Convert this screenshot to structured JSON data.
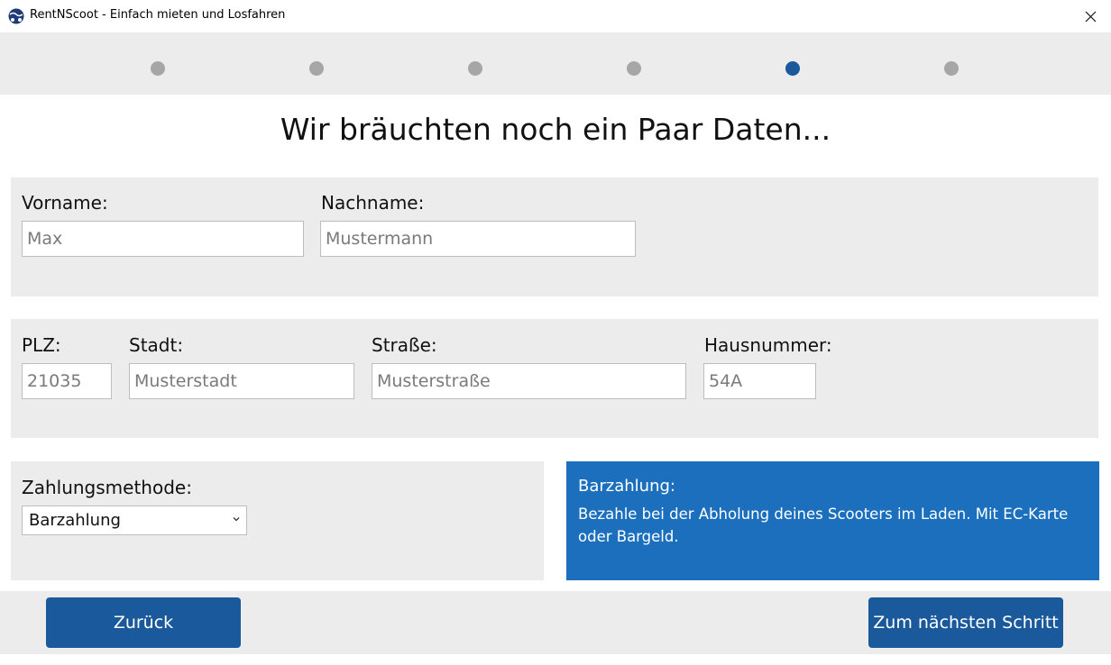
{
  "window": {
    "title": "RentNScoot - Einfach mieten und Losfahren",
    "close_icon": "close-icon"
  },
  "stepper": {
    "total_steps": 6,
    "current_step": 5,
    "inactive_color": "#a6a6a6",
    "active_color": "#1a5a9c"
  },
  "heading": "Wir bräuchten noch ein Paar Daten...",
  "name_section": {
    "vorname": {
      "label": "Vorname:",
      "placeholder": "Max",
      "value": ""
    },
    "nachname": {
      "label": "Nachname:",
      "placeholder": "Mustermann",
      "value": ""
    }
  },
  "address_section": {
    "plz": {
      "label": "PLZ:",
      "placeholder": "21035",
      "value": ""
    },
    "stadt": {
      "label": "Stadt:",
      "placeholder": "Musterstadt",
      "value": ""
    },
    "strasse": {
      "label": "Straße:",
      "placeholder": "Musterstraße",
      "value": ""
    },
    "hausnummer": {
      "label": "Hausnummer:",
      "placeholder": "54A",
      "value": ""
    }
  },
  "payment": {
    "label": "Zahlungsmethode:",
    "selected": "Barzahlung",
    "info_title": "Barzahlung:",
    "info_text": "Bezahle bei der Abholung deines Scooters im Laden. Mit EC-Karte oder Bargeld.",
    "info_color": "#1b6fbd"
  },
  "footer": {
    "back_label": "Zurück",
    "next_label": "Zum nächsten Schritt",
    "button_color": "#1a5a9c"
  }
}
